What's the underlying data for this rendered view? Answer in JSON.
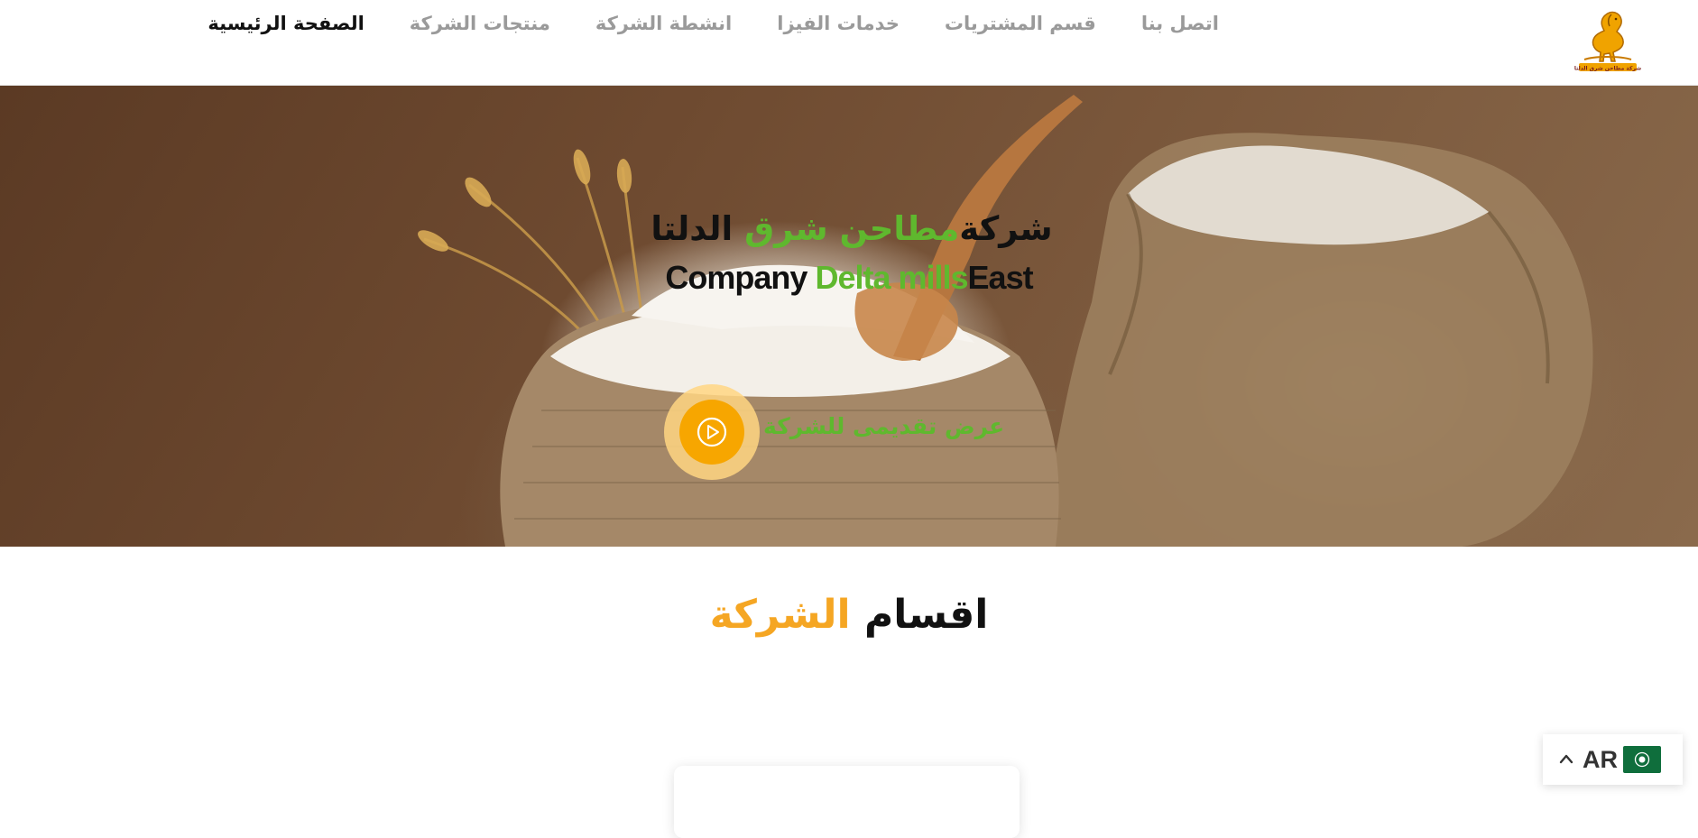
{
  "nav": {
    "items": [
      {
        "label": "الصفحة الرئيسية",
        "active": true
      },
      {
        "label": "منتجات الشركة",
        "active": false
      },
      {
        "label": "انشطة الشركة",
        "active": false
      },
      {
        "label": "خدمات الفيزا",
        "active": false
      },
      {
        "label": "قسم المشتريات",
        "active": false
      },
      {
        "label": "اتصل بنا",
        "active": false
      }
    ]
  },
  "logo": {
    "icon": "horse-logo-icon",
    "text": "شركة مطاحن شرق الدلتا"
  },
  "hero": {
    "title_ar": {
      "part1": "شركة",
      "accent": "مطاحن شرق",
      "part2": " الدلتا"
    },
    "title_en": {
      "part1": "Company ",
      "accent": "Delta  mills",
      "part2": "East"
    },
    "promo_text": "عرض تقديمى للشركة",
    "play_icon": "play-icon"
  },
  "section": {
    "title_main": "اقسام",
    "title_accent": "الشركة"
  },
  "language": {
    "code": "AR",
    "flag_icon": "arab-league-flag-icon",
    "chevron_icon": "chevron-up-icon"
  },
  "colors": {
    "accent_green": "#5fb82e",
    "accent_orange": "#f5a623",
    "play_button": "#f7a600",
    "nav_active": "#111111",
    "nav_inactive": "#9a9a9a"
  }
}
